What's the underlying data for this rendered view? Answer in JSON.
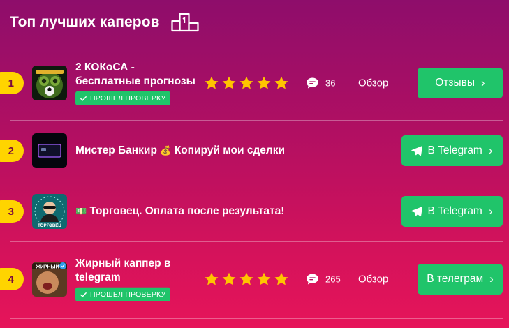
{
  "header": {
    "title": "Топ лучших каперов",
    "icon": "podium-icon"
  },
  "rows": [
    {
      "rank": "1",
      "title_line1": "2 КОКоСА -",
      "title_line2": "бесплатные прогнозы",
      "badge": "ПРОШЕЛ ПРОВЕРКУ",
      "rating": 5,
      "comments": "36",
      "review": "Обзор",
      "button": "Отзывы"
    },
    {
      "rank": "2",
      "title_part1": "Мистер Банкир",
      "title_emoji": "💰",
      "title_part2": "Копируй мои сделки",
      "button": "В Telegram"
    },
    {
      "rank": "3",
      "title_emoji": "💵",
      "title": "Торговец. Оплата после результата!",
      "logo_text": "ТОРГОВЕЦ",
      "button": "В Telegram"
    },
    {
      "rank": "4",
      "title_line1": "Жирный каппер в",
      "title_line2": "telegram",
      "badge": "ПРОШЕЛ ПРОВЕРКУ",
      "rating": 5,
      "comments": "265",
      "review": "Обзор",
      "button": "В телеграм",
      "logo_text": "ЖИРНЫЙ"
    }
  ],
  "colors": {
    "accent_green": "#20c46a",
    "rank_yellow": "#ffd400",
    "star": "#ffc400"
  }
}
